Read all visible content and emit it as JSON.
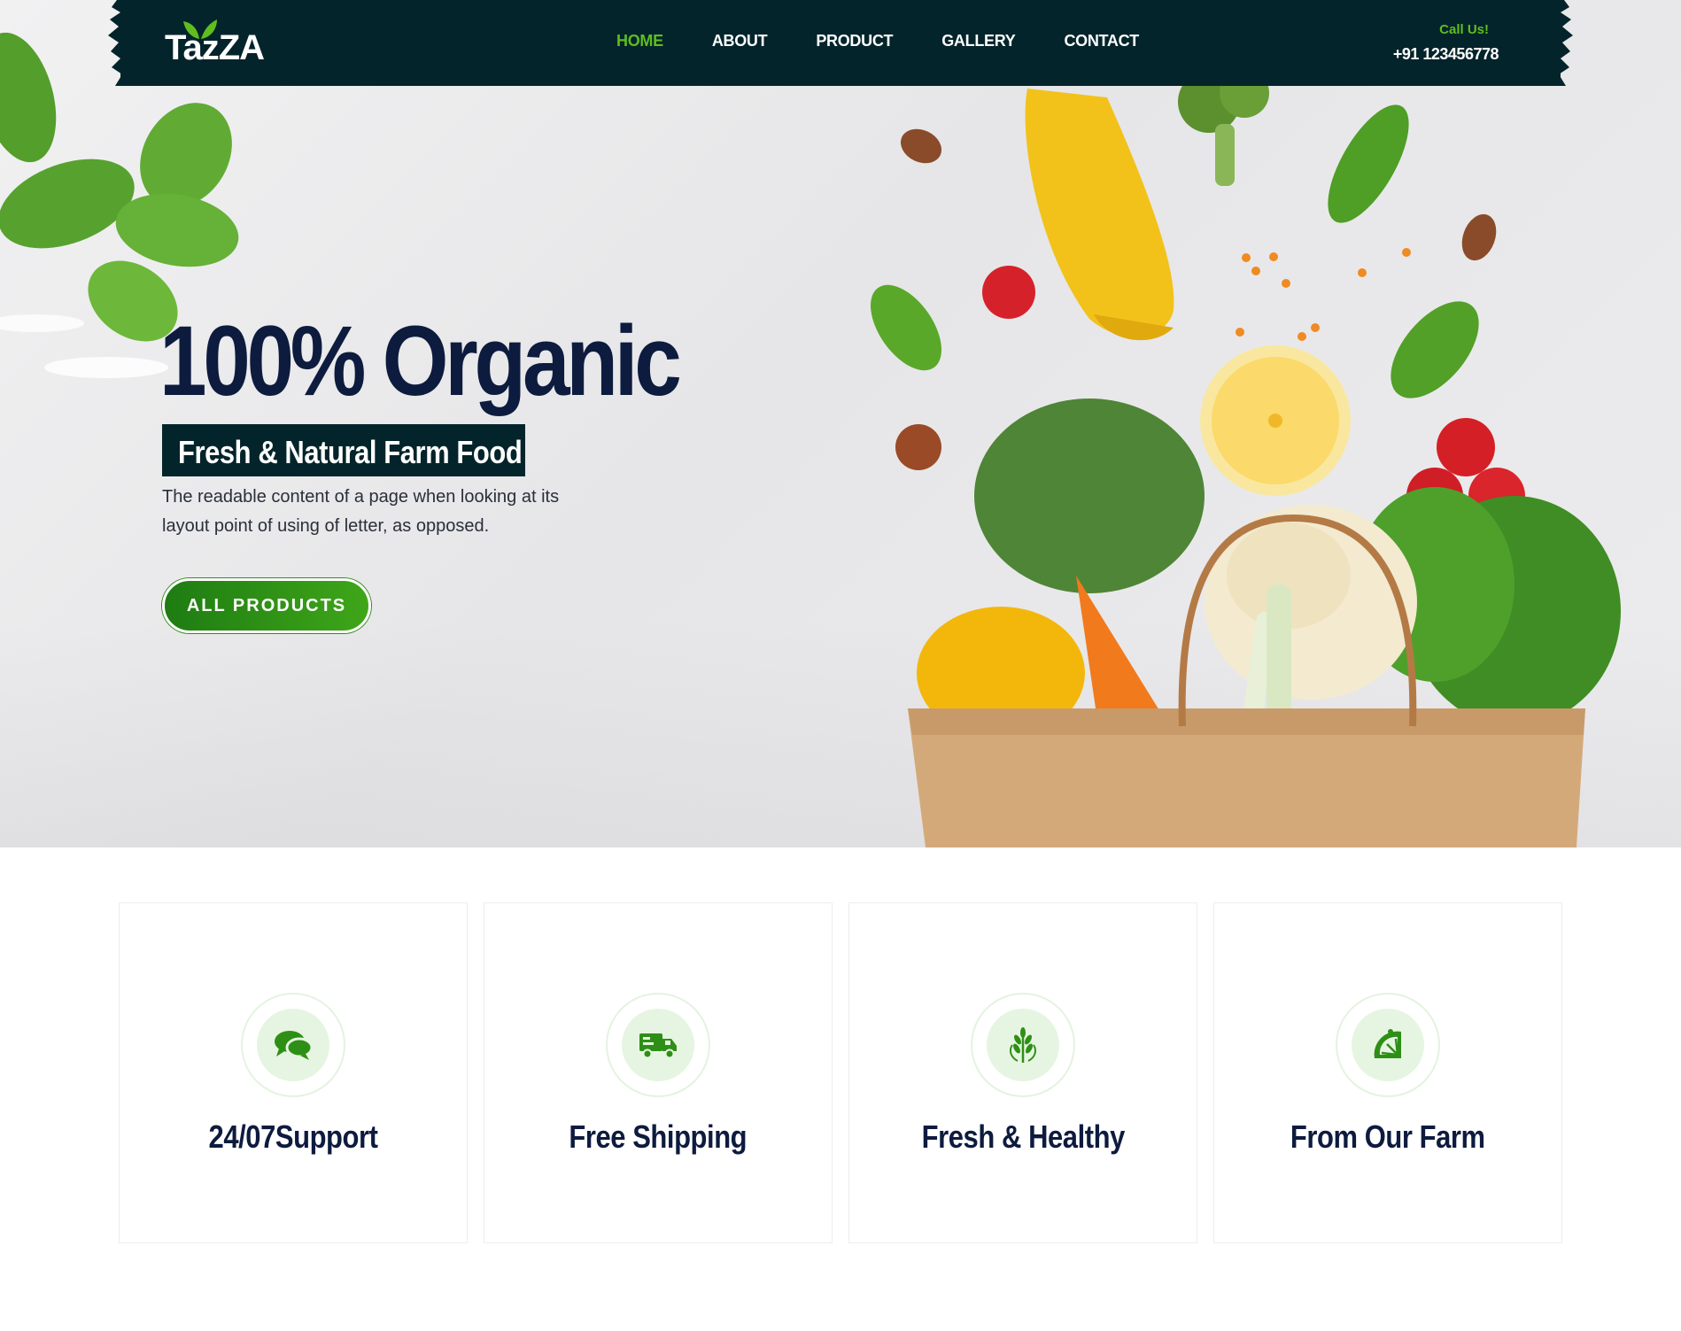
{
  "brand": {
    "logo_text": "TazZA"
  },
  "nav": {
    "items": [
      {
        "label": "HOME",
        "active": true
      },
      {
        "label": "ABOUT",
        "active": false
      },
      {
        "label": "PRODUCT",
        "active": false
      },
      {
        "label": "GALLERY",
        "active": false
      },
      {
        "label": "CONTACT",
        "active": false
      }
    ],
    "call_label": "Call Us!",
    "call_number": "+91 123456778"
  },
  "hero": {
    "title": "100% Organic",
    "subtitle": "Fresh & Natural Farm Food",
    "description": "The readable content of a page when looking at its layout point of using of letter, as opposed.",
    "button_label": "ALL PRODUCTS"
  },
  "features": [
    {
      "title": "24/07Support",
      "icon": "chat-bubbles-icon"
    },
    {
      "title": "Free Shipping",
      "icon": "delivery-truck-icon"
    },
    {
      "title": "Fresh & Healthy",
      "icon": "wheat-icon"
    },
    {
      "title": "From Our Farm",
      "icon": "lime-slice-icon"
    }
  ],
  "colors": {
    "dark_navy": "#03242a",
    "accent_green": "#5fbd1e",
    "button_green": "#2e8f16",
    "heading": "#0d1b3e",
    "icon_bg": "#e6f5e1"
  }
}
